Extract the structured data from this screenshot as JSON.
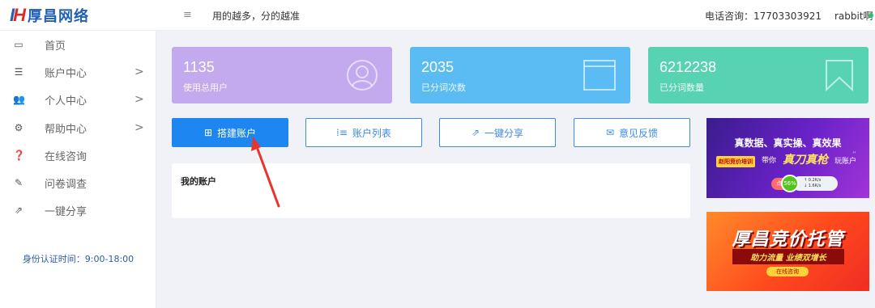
{
  "header": {
    "logo_mark_left": "I",
    "logo_mark_right": "H",
    "logo_text": "厚昌网络",
    "menu_toggle_icon": "hamburger-icon",
    "slogan": "用的越多，分的越准",
    "phone": "电话咨询：17703303921",
    "username": "rabbit啊"
  },
  "sidebar": {
    "items": [
      {
        "label": "首页",
        "icon": "laptop-icon",
        "has_arrow": false
      },
      {
        "label": "账户中心",
        "icon": "list-icon",
        "has_arrow": true
      },
      {
        "label": "个人中心",
        "icon": "users-icon",
        "has_arrow": true
      },
      {
        "label": "帮助中心",
        "icon": "cogs-icon",
        "has_arrow": true
      },
      {
        "label": "在线咨询",
        "icon": "question-icon",
        "has_arrow": false
      },
      {
        "label": "问卷调查",
        "icon": "edit-icon",
        "has_arrow": false
      },
      {
        "label": "一键分享",
        "icon": "share-icon",
        "has_arrow": false
      }
    ],
    "arrow_glyph": ">",
    "auth_time": "身份认证时间：9:00-18:00"
  },
  "stats": [
    {
      "value": "1135",
      "label": "使用总用户",
      "color": "#c3a9ed",
      "icon": "user-circle-icon"
    },
    {
      "value": "2035",
      "label": "已分词次数",
      "color": "#5bbcf3",
      "icon": "window-icon"
    },
    {
      "value": "6212238",
      "label": "已分词数量",
      "color": "#58d3b2",
      "icon": "bookmark-icon"
    }
  ],
  "actions": [
    {
      "label": "搭建账户",
      "icon": "plus-square-icon",
      "glyph": "⊞",
      "primary": true
    },
    {
      "label": "账户列表",
      "icon": "list-ol-icon",
      "glyph": "⁞≡",
      "primary": false
    },
    {
      "label": "一键分享",
      "icon": "share-square-icon",
      "glyph": "⇗",
      "primary": false
    },
    {
      "label": "意见反馈",
      "icon": "envelope-icon",
      "glyph": "✉",
      "primary": false
    }
  ],
  "panel": {
    "title": "我的账户"
  },
  "ads": {
    "ad1": {
      "headline": "真数据、真实操、真效果",
      "tag": "赵阳竞价培训",
      "mid": "带你",
      "big": "真刀真枪",
      "tail": "玩账户",
      "pill": "点击咨询",
      "gauge": "56%",
      "up_rate": "0.2K/s",
      "down_rate": "1.6K/s"
    },
    "ad2": {
      "headline": "厚昌竞价托管",
      "sub": "助力流量 业绩双增长",
      "cta": "在线咨询"
    }
  },
  "colors": {
    "accent": "#1e86f0",
    "brand_red": "#e02727",
    "brand_blue": "#1f5fb8",
    "annotation": "#e8352b"
  }
}
